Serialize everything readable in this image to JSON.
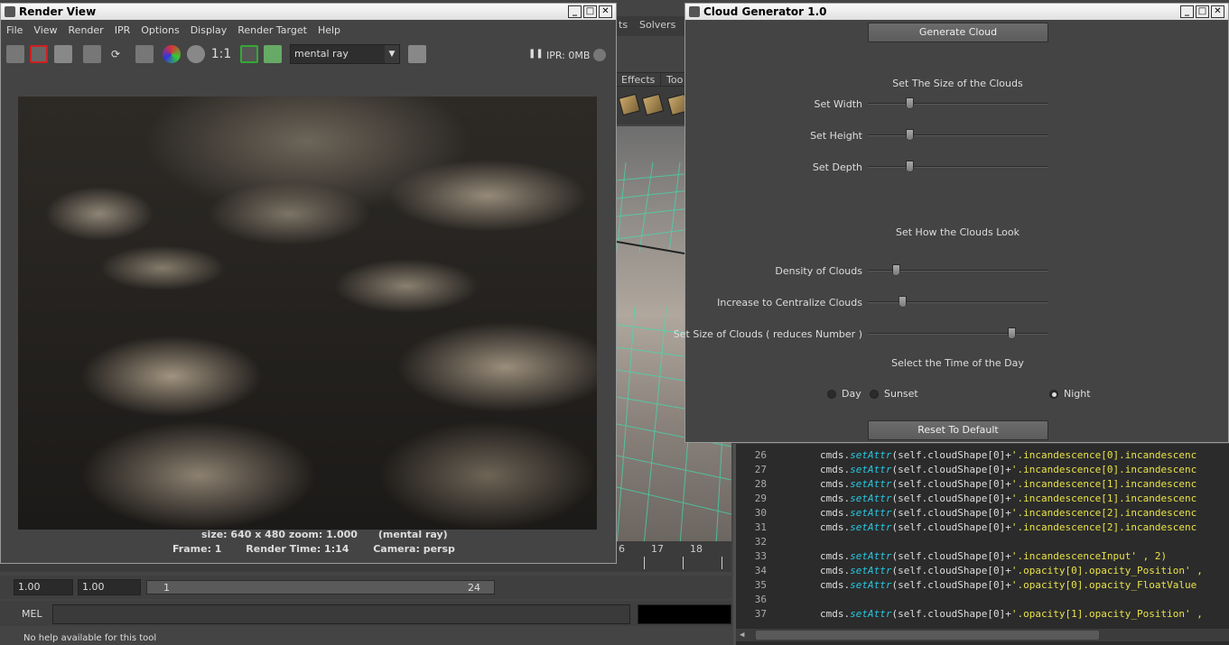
{
  "background": {
    "solvers_menu": "Solvers",
    "menu_fragment": "ts",
    "shelf_tabs": [
      "Effects",
      "Too"
    ],
    "time_ticks": [
      "6",
      "17",
      "18"
    ],
    "range": {
      "start1": "1.00",
      "start2": "1.00",
      "slider_start": "1",
      "slider_end": "24"
    },
    "mel_label": "MEL",
    "help_line": "No help available for this tool"
  },
  "render_view": {
    "title": "Render View",
    "menu": [
      "File",
      "View",
      "Render",
      "IPR",
      "Options",
      "Display",
      "Render Target",
      "Help"
    ],
    "ratio_label": "1:1",
    "renderer": "mental ray",
    "ipr_label": "IPR: 0MB",
    "status_line1": "size: 640 x 480 zoom: 1.000      (mental ray)",
    "status_line2": "Frame: 1       Render Time: 1:14       Camera: persp"
  },
  "cloud_generator": {
    "title": "Cloud Generator 1.0",
    "generate_label": "Generate Cloud",
    "size_heading": "Set The Size of the Clouds",
    "width_label": "Set Width",
    "height_label": "Set Height",
    "depth_label": "Set Depth",
    "look_heading": "Set How the Clouds Look",
    "density_label": "Density of Clouds",
    "centralize_label": "Increase to Centralize Clouds",
    "size_clouds_label": "Set Size of Clouds ( reduces Number )",
    "time_heading": "Select the Time of the Day",
    "radio_day": "Day",
    "radio_sunset": "Sunset",
    "radio_night": "Night",
    "selected_time": "Night",
    "reset_label": "Reset To Default",
    "slider_levels": {
      "width": 0.22,
      "height": 0.22,
      "depth": 0.22,
      "density": 0.14,
      "centralize": 0.18,
      "size_clouds": 0.81
    }
  },
  "script_editor": {
    "lines": [
      {
        "n": "26",
        "pre": "        cmds.",
        "fn": "setAttr",
        "mid": "(self.cloudShape[0]+",
        "str": "'.incandescence[0].incandescenc"
      },
      {
        "n": "27",
        "pre": "        cmds.",
        "fn": "setAttr",
        "mid": "(self.cloudShape[0]+",
        "str": "'.incandescence[0].incandescenc"
      },
      {
        "n": "28",
        "pre": "        cmds.",
        "fn": "setAttr",
        "mid": "(self.cloudShape[0]+",
        "str": "'.incandescence[1].incandescenc"
      },
      {
        "n": "29",
        "pre": "        cmds.",
        "fn": "setAttr",
        "mid": "(self.cloudShape[0]+",
        "str": "'.incandescence[1].incandescenc"
      },
      {
        "n": "30",
        "pre": "        cmds.",
        "fn": "setAttr",
        "mid": "(self.cloudShape[0]+",
        "str": "'.incandescence[2].incandescenc"
      },
      {
        "n": "31",
        "pre": "        cmds.",
        "fn": "setAttr",
        "mid": "(self.cloudShape[0]+",
        "str": "'.incandescence[2].incandescenc"
      },
      {
        "n": "32",
        "pre": "",
        "fn": "",
        "mid": "",
        "str": ""
      },
      {
        "n": "33",
        "pre": "        cmds.",
        "fn": "setAttr",
        "mid": "(self.cloudShape[0]+",
        "str": "'.incandescenceInput' , 2)"
      },
      {
        "n": "34",
        "pre": "        cmds.",
        "fn": "setAttr",
        "mid": "(self.cloudShape[0]+",
        "str": "'.opacity[0].opacity_Position' ,"
      },
      {
        "n": "35",
        "pre": "        cmds.",
        "fn": "setAttr",
        "mid": "(self.cloudShape[0]+",
        "str": "'.opacity[0].opacity_FloatValue"
      },
      {
        "n": "36",
        "pre": "",
        "fn": "",
        "mid": "",
        "str": ""
      },
      {
        "n": "37",
        "pre": "        cmds.",
        "fn": "setAttr",
        "mid": "(self.cloudShape[0]+",
        "str": "'.opacity[1].opacity_Position' ,"
      }
    ]
  }
}
